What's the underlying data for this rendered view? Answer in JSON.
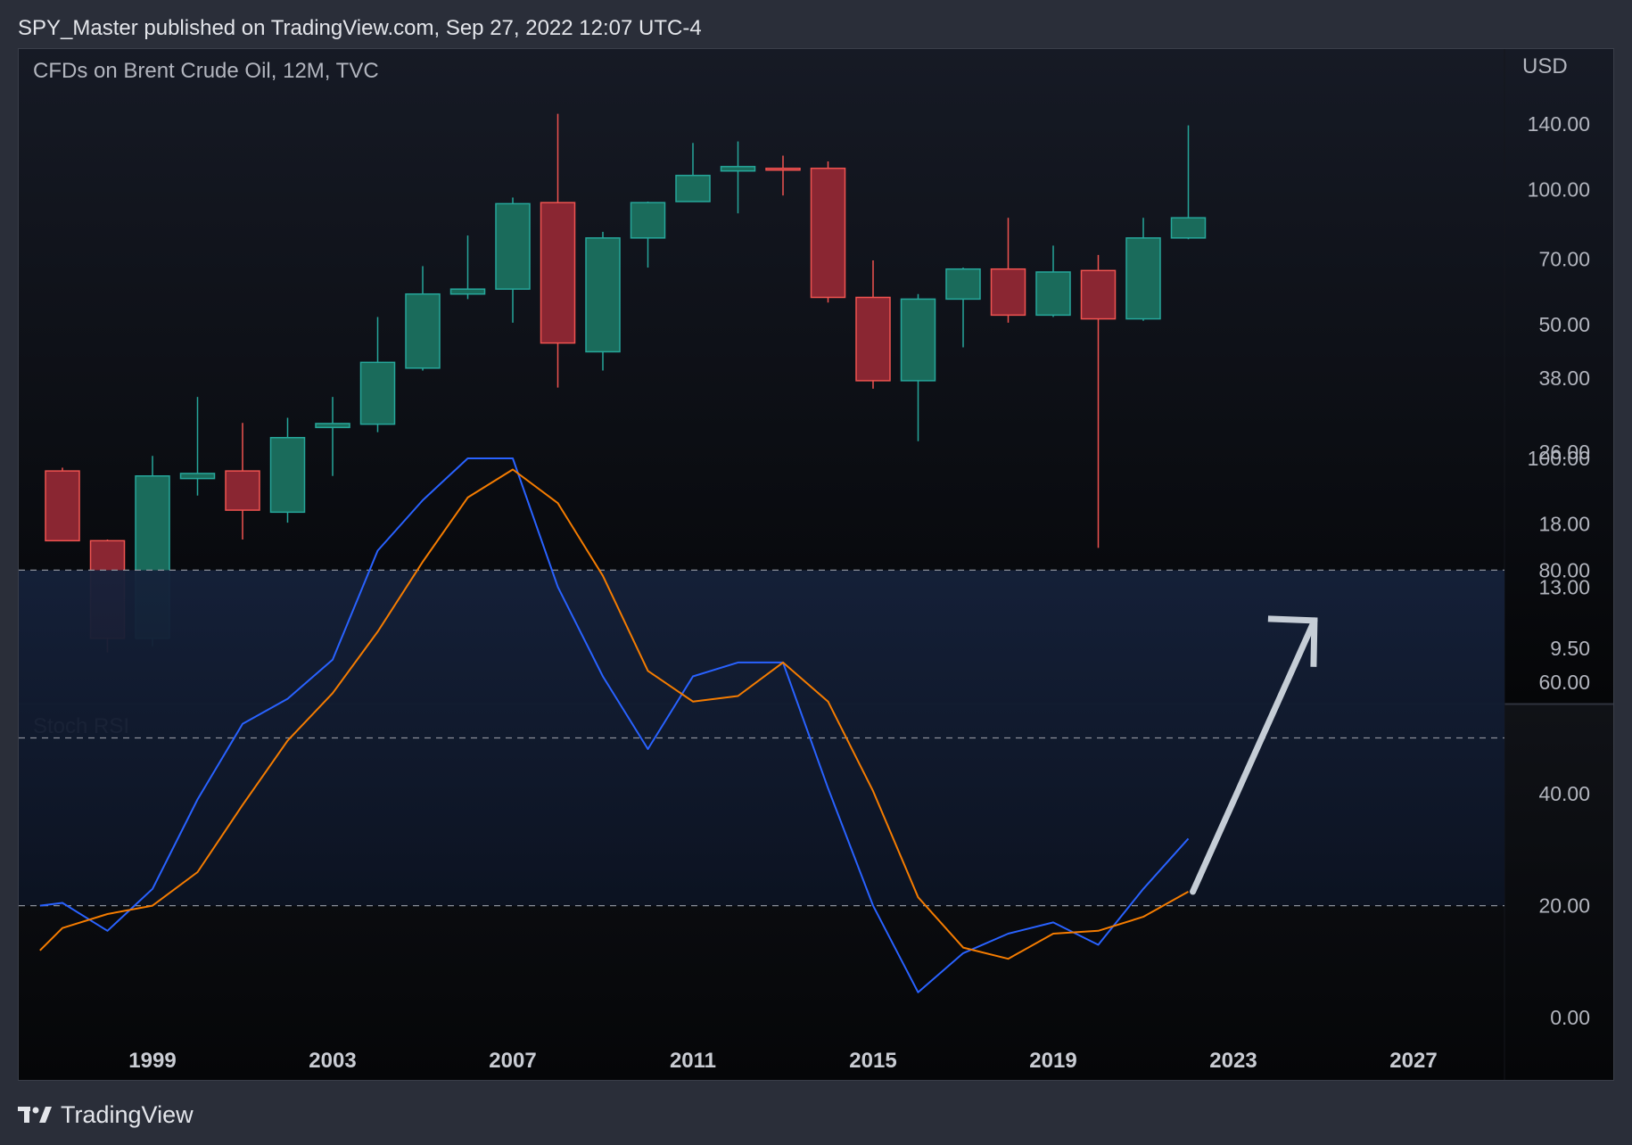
{
  "header": {
    "published_text": "SPY_Master published on TradingView.com, Sep 27, 2022 12:07 UTC-4"
  },
  "footer": {
    "brand": "TradingView",
    "logo_icon": "tradingview-logo-icon"
  },
  "colors": {
    "up": "#1a6b5b",
    "up_border": "#26a69a",
    "down": "#8a2632",
    "down_border": "#ef5350",
    "stoch_k": "#2962ff",
    "stoch_d": "#f57c00",
    "band": "#16213a",
    "text": "#b2b5be",
    "arrow": "#c5cdd6"
  },
  "chart_data": [
    {
      "type": "candlestick",
      "title": "CFDs on Brent Crude Oil, 12M, TVC",
      "currency_label": "USD",
      "y_scale": "log",
      "y_ticks": [
        "140.00",
        "100.00",
        "70.00",
        "50.00",
        "38.00",
        "26.00",
        "18.00",
        "13.00",
        "9.50"
      ],
      "x_ticks": [
        "1999",
        "2003",
        "2007",
        "2011",
        "2015",
        "2019",
        "2023",
        "2027"
      ],
      "candles": [
        {
          "year": 1997,
          "open": 23.6,
          "high": 24.0,
          "low": 16.5,
          "close": 16.5
        },
        {
          "year": 1998,
          "open": 16.5,
          "high": 16.6,
          "low": 9.3,
          "close": 10.0
        },
        {
          "year": 1999,
          "open": 10.0,
          "high": 25.5,
          "low": 9.6,
          "close": 23.0
        },
        {
          "year": 2000,
          "open": 22.7,
          "high": 34.5,
          "low": 20.8,
          "close": 23.3
        },
        {
          "year": 2001,
          "open": 23.6,
          "high": 30.2,
          "low": 16.6,
          "close": 19.3
        },
        {
          "year": 2002,
          "open": 19.1,
          "high": 31.0,
          "low": 18.1,
          "close": 28.0
        },
        {
          "year": 2003,
          "open": 29.5,
          "high": 34.5,
          "low": 23.0,
          "close": 30.1
        },
        {
          "year": 2004,
          "open": 30.0,
          "high": 52.0,
          "low": 28.8,
          "close": 41.2
        },
        {
          "year": 2005,
          "open": 40.0,
          "high": 67.5,
          "low": 39.5,
          "close": 58.5
        },
        {
          "year": 2006,
          "open": 58.5,
          "high": 79.0,
          "low": 57.0,
          "close": 60.0
        },
        {
          "year": 2007,
          "open": 60.0,
          "high": 96.0,
          "low": 50.5,
          "close": 93.0
        },
        {
          "year": 2008,
          "open": 93.5,
          "high": 147.5,
          "low": 36.2,
          "close": 45.5
        },
        {
          "year": 2009,
          "open": 43.5,
          "high": 80.5,
          "low": 39.5,
          "close": 78.0
        },
        {
          "year": 2010,
          "open": 78.0,
          "high": 94.0,
          "low": 67.0,
          "close": 93.5
        },
        {
          "year": 2011,
          "open": 94.0,
          "high": 127.0,
          "low": 94.0,
          "close": 107.5
        },
        {
          "year": 2012,
          "open": 110.0,
          "high": 128.0,
          "low": 88.5,
          "close": 112.5
        },
        {
          "year": 2013,
          "open": 111.5,
          "high": 119.0,
          "low": 97.0,
          "close": 111.0
        },
        {
          "year": 2014,
          "open": 111.5,
          "high": 115.5,
          "low": 56.0,
          "close": 57.5
        },
        {
          "year": 2015,
          "open": 57.5,
          "high": 69.5,
          "low": 36.0,
          "close": 37.5
        },
        {
          "year": 2016,
          "open": 37.5,
          "high": 58.5,
          "low": 27.5,
          "close": 57.0
        },
        {
          "year": 2017,
          "open": 57.0,
          "high": 67.0,
          "low": 44.5,
          "close": 66.5
        },
        {
          "year": 2018,
          "open": 66.5,
          "high": 86.5,
          "low": 50.5,
          "close": 52.5
        },
        {
          "year": 2019,
          "open": 52.5,
          "high": 75.0,
          "low": 52.0,
          "close": 65.5
        },
        {
          "year": 2020,
          "open": 66.0,
          "high": 71.5,
          "low": 15.9,
          "close": 51.5
        },
        {
          "year": 2021,
          "open": 51.5,
          "high": 86.5,
          "low": 51.0,
          "close": 78.0
        },
        {
          "year": 2022,
          "open": 78.0,
          "high": 139.0,
          "low": 77.5,
          "close": 86.5
        }
      ]
    },
    {
      "type": "line",
      "title": "Stoch RSI",
      "ylim": [
        0,
        100
      ],
      "y_ticks": [
        "100.00",
        "80.00",
        "60.00",
        "40.00",
        "20.00",
        "0.00"
      ],
      "band": [
        20,
        80
      ],
      "midline": 50,
      "x": [
        1996.5,
        1997,
        1998,
        1999,
        2000,
        2001,
        2002,
        2003,
        2004,
        2005,
        2006,
        2007,
        2008,
        2009,
        2010,
        2011,
        2012,
        2013,
        2014,
        2015,
        2016,
        2017,
        2018,
        2019,
        2020,
        2021,
        2022
      ],
      "series": [
        {
          "key": "k",
          "values": [
            20,
            20.5,
            15.5,
            23,
            39,
            52.5,
            57,
            64,
            83.5,
            92.5,
            100,
            100,
            77,
            61,
            48,
            61,
            63.5,
            63.5,
            41,
            20,
            4.5,
            11.5,
            15,
            17,
            13,
            23,
            32
          ]
        },
        {
          "key": "d",
          "values": [
            12,
            16,
            18.5,
            20,
            26,
            38,
            49.5,
            58,
            69,
            81.5,
            93,
            98,
            92,
            79,
            62,
            56.5,
            57.5,
            63.5,
            56.5,
            40.5,
            21.5,
            12.5,
            10.5,
            15,
            15.5,
            18,
            22.5
          ]
        }
      ],
      "annotation": "up-arrow"
    }
  ]
}
